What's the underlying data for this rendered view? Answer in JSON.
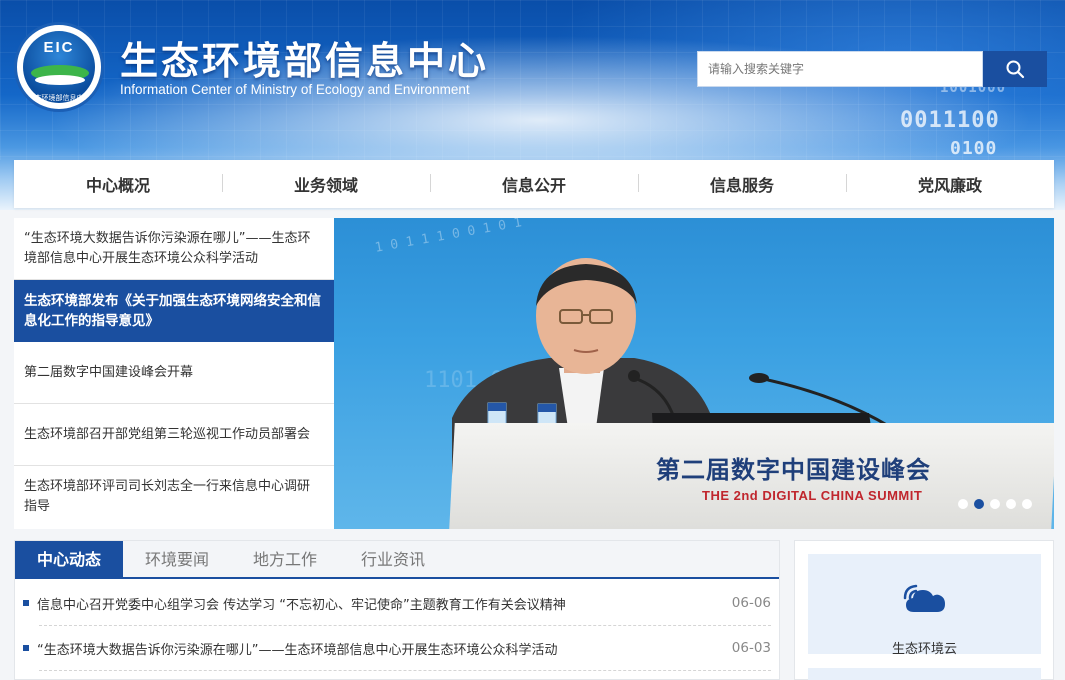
{
  "header": {
    "title": "生态环境部信息中心",
    "subtitle": "Information Center of Ministry of Ecology and Environment",
    "logo_text": "EIC",
    "logo_ring_text": "生态环境部信息中心",
    "search_placeholder": "请输入搜索关键字"
  },
  "nav": {
    "items": [
      "中心概况",
      "业务领域",
      "信息公开",
      "信息服务",
      "党风廉政"
    ]
  },
  "headlines": [
    "“生态环境大数据告诉你污染源在哪儿”——生态环境部信息中心开展生态环境公众科学活动",
    "生态环境部发布《关于加强生态环境网络安全和信息化工作的指导意见》",
    "第二届数字中国建设峰会开幕",
    "生态环境部召开部党组第三轮巡视工作动员部署会",
    "生态环境部环评司司长刘志全一行来信息中心调研指导"
  ],
  "slider": {
    "podium_text": "第二届数字中国建设峰会",
    "podium_subtext": "THE 2nd DIGITAL CHINA SUMMIT",
    "background_digits": "1 0 1 1 1 0 0 1 0 1",
    "dot_count": 5,
    "active_dot": 2
  },
  "news": {
    "tabs": [
      "中心动态",
      "环境要闻",
      "地方工作",
      "行业资讯"
    ],
    "items": [
      {
        "title": "信息中心召开党委中心组学习会 传达学习 “不忘初心、牢记使命”主题教育工作有关会议精神",
        "date": "06-06"
      },
      {
        "title": "“生态环境大数据告诉你污染源在哪儿”——生态环境部信息中心开展生态环境公众科学活动",
        "date": "06-03"
      }
    ]
  },
  "side": {
    "card_label": "生态环境云"
  },
  "colors": {
    "brand_blue": "#1a4fa0"
  }
}
